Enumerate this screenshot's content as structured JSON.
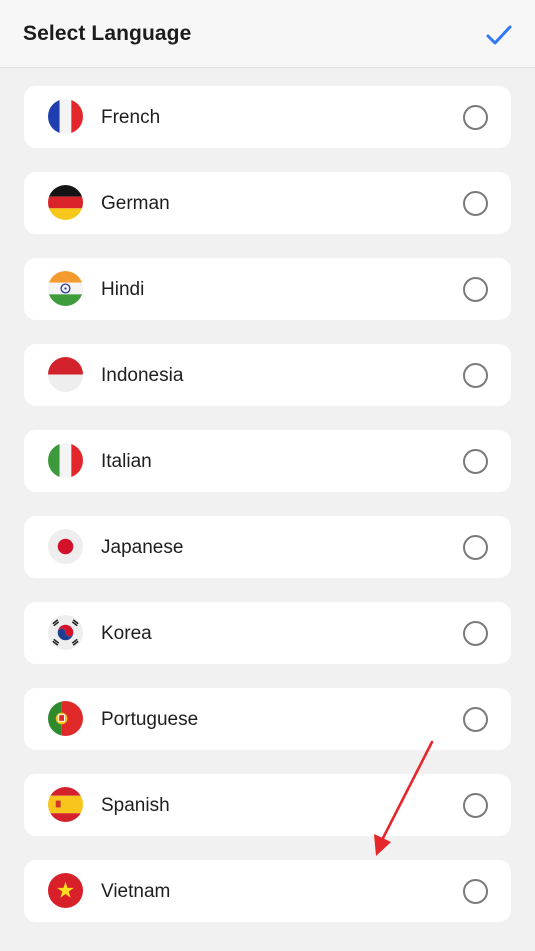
{
  "header": {
    "title": "Select Language",
    "confirm_icon": "checkmark-icon",
    "accent_color": "#3478f6"
  },
  "languages": [
    {
      "label": "French",
      "flag": "france-flag-icon",
      "selected": false
    },
    {
      "label": "German",
      "flag": "germany-flag-icon",
      "selected": false
    },
    {
      "label": "Hindi",
      "flag": "india-flag-icon",
      "selected": false
    },
    {
      "label": "Indonesia",
      "flag": "indonesia-flag-icon",
      "selected": false
    },
    {
      "label": "Italian",
      "flag": "italy-flag-icon",
      "selected": false
    },
    {
      "label": "Japanese",
      "flag": "japan-flag-icon",
      "selected": false
    },
    {
      "label": "Korea",
      "flag": "south-korea-flag-icon",
      "selected": false
    },
    {
      "label": "Portuguese",
      "flag": "portugal-flag-icon",
      "selected": false
    },
    {
      "label": "Spanish",
      "flag": "spain-flag-icon",
      "selected": false
    },
    {
      "label": "Vietnam",
      "flag": "vietnam-flag-icon",
      "selected": false
    }
  ],
  "annotation": {
    "icon": "red-arrow-icon",
    "color": "#e8262a"
  }
}
